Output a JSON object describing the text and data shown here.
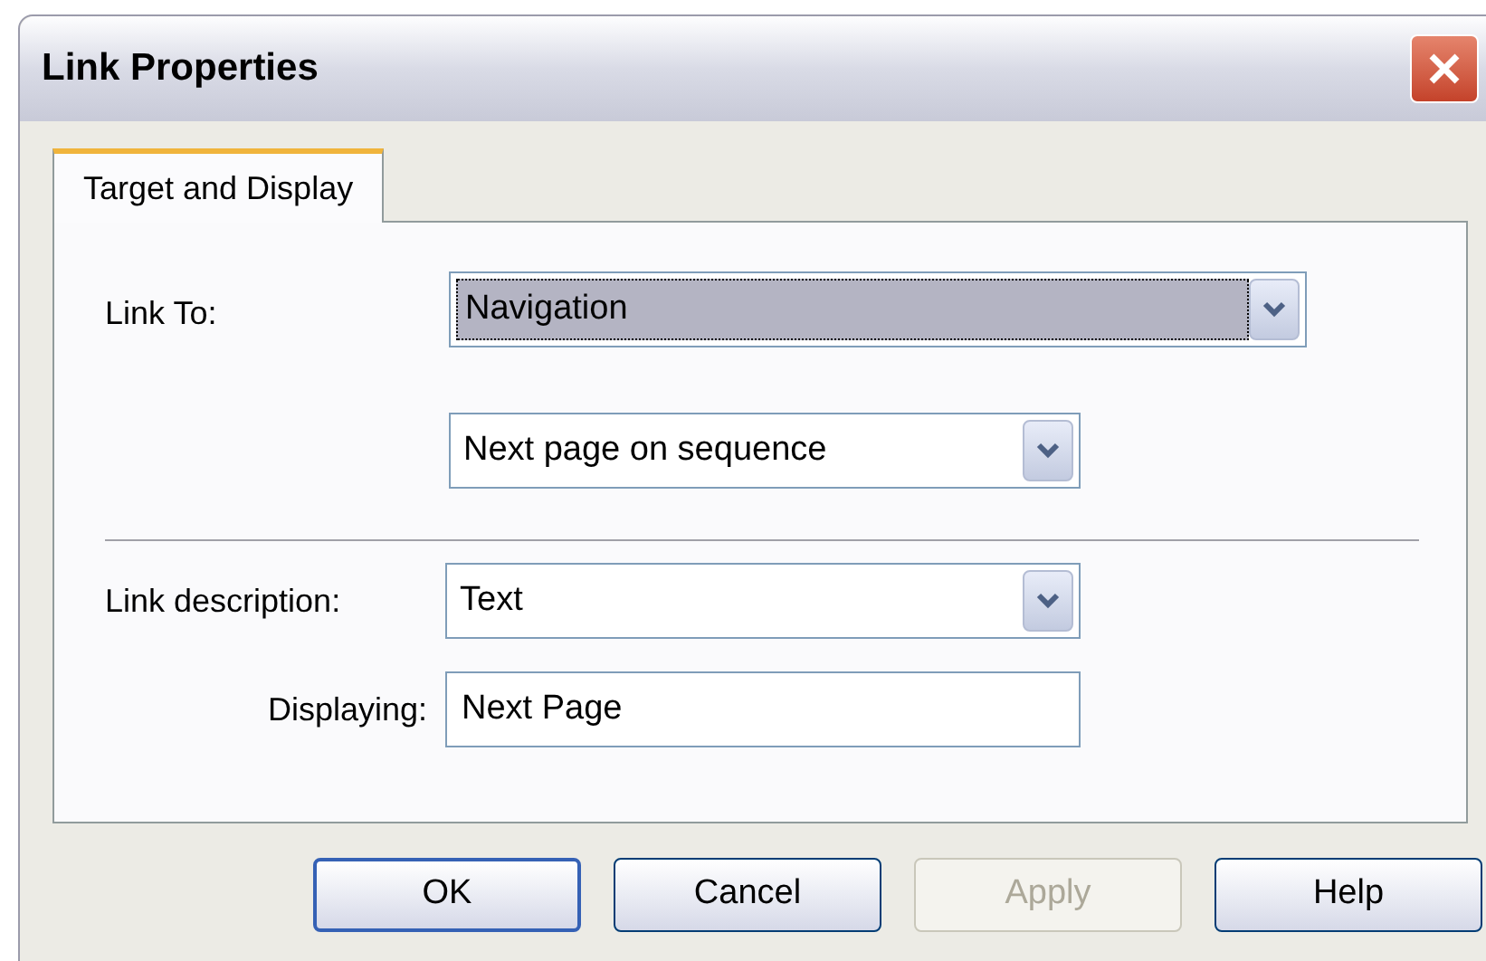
{
  "window": {
    "title": "Link Properties"
  },
  "tabs": [
    {
      "label": "Target and Display",
      "selected": true
    }
  ],
  "link_to": {
    "label": "Link To:",
    "dropdowns": [
      {
        "value": "Navigation",
        "focused": true
      },
      {
        "value": "Next page on sequence",
        "focused": false
      }
    ]
  },
  "link_description": {
    "label": "Link description:",
    "value": "Text"
  },
  "displaying": {
    "label": "Displaying:",
    "value": "Next Page"
  },
  "buttons": [
    {
      "label": "OK",
      "default": true,
      "disabled": false
    },
    {
      "label": "Cancel",
      "default": false,
      "disabled": false
    },
    {
      "label": "Apply",
      "default": false,
      "disabled": true
    },
    {
      "label": "Help",
      "default": false,
      "disabled": false
    }
  ]
}
